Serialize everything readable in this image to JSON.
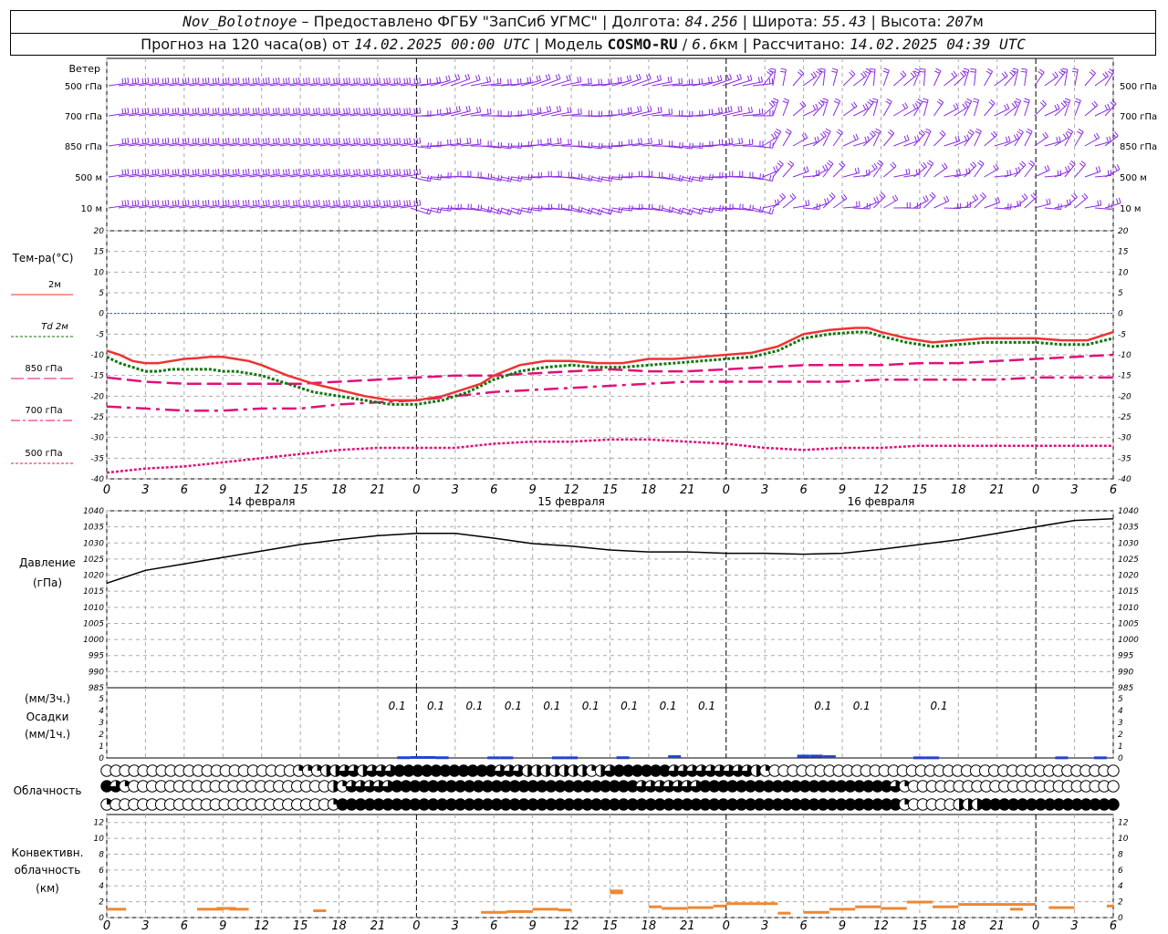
{
  "header": {
    "station": "Nov_Bolotnoye",
    "provider": "Предоставлено ФГБУ \"ЗапСиб УГМС\"",
    "lon_label": "Долгота:",
    "lon": "84.256",
    "lat_label": "Широта:",
    "lat": "55.43",
    "alt_label": "Высота:",
    "alt": "207",
    "alt_unit": "м",
    "forecast_prefix": "Прогноз на 120 часа(ов) от",
    "forecast_time": "14.02.2025 00:00 UTC",
    "model_label": "Модель",
    "model": "COSMO-RU",
    "resolution": "6.6",
    "resolution_unit": "км",
    "computed_label": "Рассчитано:",
    "computed_time": "14.02.2025 04:39 UTC"
  },
  "colors": {
    "wind": "#8a2be2",
    "t2m": "#ee3333",
    "td2m": "#117711",
    "t850": "#e0107a",
    "t700": "#e0107a",
    "t500": "#e0107a",
    "zero_line": "#3344ff",
    "pressure": "#000000",
    "precip": "#2244cc",
    "conv": "#ee8833",
    "grid": "#aaaaaa"
  },
  "labels": {
    "wind_title": "Ветер",
    "wind_levels": [
      "500 гПа",
      "700 гПа",
      "850 гПа",
      "500 м",
      "10 м"
    ],
    "temp_title": "Тем-ра(°С)",
    "temp_series": [
      "2м",
      "Td 2м",
      "850 гПа",
      "700 гПа",
      "500 гПа"
    ],
    "pressure_title": "Давление",
    "pressure_unit": "(гПа)",
    "precip_unit_3h": "(мм/3ч.)",
    "precip_title": "Осадки",
    "precip_unit_1h": "(мм/1ч.)",
    "cloud_title": "Облачность",
    "conv_title_1": "Конвективн.",
    "conv_title_2": "облачность",
    "conv_unit": "(км)",
    "date_labels": [
      "14 февраля",
      "15 февраля",
      "16 февраля"
    ]
  },
  "time_axis": {
    "tick_labels": [
      "0",
      "3",
      "6",
      "9",
      "12",
      "15",
      "18",
      "21",
      "0",
      "3",
      "6",
      "9",
      "12",
      "15",
      "18",
      "21",
      "0",
      "3",
      "6",
      "9",
      "12",
      "15",
      "18",
      "21",
      "0",
      "3",
      "6"
    ],
    "hours": [
      0,
      3,
      6,
      9,
      12,
      15,
      18,
      21,
      24,
      27,
      30,
      33,
      36,
      39,
      42,
      45,
      48,
      51,
      54,
      57,
      60,
      63,
      66,
      69,
      72,
      75,
      78
    ]
  },
  "chart_data": [
    {
      "type": "line",
      "ylim": [
        -40,
        20
      ],
      "yticks": [
        20,
        15,
        10,
        5,
        0,
        -5,
        -10,
        -15,
        -20,
        -25,
        -30,
        -35,
        -40
      ],
      "series": [
        {
          "name": "2м",
          "x": [
            0,
            1,
            2,
            3,
            4,
            5,
            6,
            7,
            8,
            9,
            10,
            11,
            12,
            14,
            16,
            18,
            20,
            22,
            24,
            26,
            28,
            29,
            30,
            32,
            34,
            36,
            38,
            40,
            42,
            44,
            46,
            48,
            50,
            52,
            54,
            56,
            58,
            59,
            60,
            62,
            64,
            66,
            68,
            70,
            72,
            74,
            76,
            78
          ],
          "values": [
            -9,
            -10,
            -11.5,
            -12,
            -12,
            -11.5,
            -11,
            -10.8,
            -10.5,
            -10.5,
            -11,
            -11.5,
            -12.5,
            -15,
            -17,
            -18.5,
            -20,
            -21,
            -21,
            -20,
            -18,
            -17,
            -15,
            -12.5,
            -11.5,
            -11.5,
            -12,
            -12,
            -11,
            -11,
            -10.5,
            -10,
            -9.5,
            -8,
            -5,
            -4,
            -3.5,
            -3.5,
            -4.5,
            -6,
            -7,
            -6.5,
            -6,
            -6,
            -6,
            -6.5,
            -6.5,
            -4.5
          ]
        },
        {
          "name": "Td 2м",
          "x": [
            0,
            1,
            2,
            3,
            4,
            5,
            6,
            7,
            8,
            9,
            10,
            11,
            12,
            14,
            16,
            18,
            20,
            22,
            24,
            26,
            28,
            29,
            30,
            32,
            34,
            36,
            38,
            40,
            42,
            44,
            46,
            48,
            50,
            52,
            54,
            56,
            58,
            59,
            60,
            62,
            64,
            66,
            68,
            70,
            72,
            74,
            76,
            78
          ],
          "values": [
            -10.5,
            -12,
            -13,
            -14,
            -14,
            -13.5,
            -13.5,
            -13.5,
            -13.5,
            -14,
            -14,
            -14.5,
            -15,
            -17,
            -19,
            -20,
            -21,
            -22,
            -22,
            -21,
            -19,
            -17.5,
            -16,
            -14,
            -13,
            -12.5,
            -13,
            -13,
            -12.5,
            -12,
            -11.5,
            -11,
            -10.5,
            -9,
            -6,
            -5,
            -4.5,
            -4.5,
            -5.5,
            -7,
            -8,
            -7.5,
            -7,
            -7,
            -7,
            -7.5,
            -7.5,
            -6
          ]
        },
        {
          "name": "850 гПа",
          "x": [
            0,
            3,
            6,
            9,
            12,
            15,
            18,
            21,
            24,
            27,
            30,
            33,
            36,
            39,
            42,
            45,
            48,
            51,
            54,
            57,
            60,
            63,
            66,
            69,
            72,
            75,
            78
          ],
          "values": [
            -15.5,
            -16.5,
            -17,
            -17,
            -17,
            -17,
            -16.5,
            -16,
            -15.5,
            -15,
            -15,
            -14.5,
            -14,
            -13.5,
            -14,
            -14,
            -13.5,
            -13,
            -12.5,
            -12.5,
            -12.5,
            -12,
            -12,
            -11.5,
            -11,
            -10.5,
            -10
          ]
        },
        {
          "name": "700 гПа",
          "x": [
            0,
            3,
            6,
            9,
            12,
            15,
            18,
            21,
            24,
            27,
            30,
            33,
            36,
            39,
            42,
            45,
            48,
            51,
            54,
            57,
            60,
            63,
            66,
            69,
            72,
            75,
            78
          ],
          "values": [
            -22.5,
            -23,
            -23.5,
            -23.5,
            -23,
            -23,
            -22,
            -21.5,
            -21,
            -20,
            -19,
            -18.5,
            -18,
            -17.5,
            -17,
            -16.5,
            -16.5,
            -16.5,
            -16.5,
            -16.5,
            -16,
            -16,
            -16,
            -16,
            -15.5,
            -15.5,
            -15.5
          ]
        },
        {
          "name": "500 гПа",
          "x": [
            0,
            3,
            6,
            9,
            12,
            15,
            18,
            21,
            24,
            27,
            30,
            33,
            36,
            39,
            42,
            45,
            48,
            51,
            54,
            57,
            60,
            63,
            66,
            69,
            72,
            75,
            78
          ],
          "values": [
            -38.5,
            -37.5,
            -37,
            -36,
            -35,
            -34,
            -33,
            -32.5,
            -32.5,
            -32.5,
            -31.5,
            -31,
            -31,
            -30.5,
            -30.5,
            -31,
            -31.5,
            -32.5,
            -33,
            -32.5,
            -32.5,
            -32,
            -32,
            -32,
            -32,
            -32,
            -32
          ]
        }
      ]
    },
    {
      "type": "line",
      "ylim": [
        985,
        1040
      ],
      "yticks": [
        1040,
        1035,
        1030,
        1025,
        1020,
        1015,
        1010,
        1005,
        1000,
        995,
        990,
        985
      ],
      "series": [
        {
          "name": "Давление",
          "x": [
            0,
            3,
            6,
            9,
            12,
            15,
            18,
            21,
            24,
            27,
            30,
            33,
            36,
            39,
            42,
            45,
            48,
            51,
            54,
            57,
            60,
            63,
            66,
            69,
            72,
            75,
            78
          ],
          "values": [
            1017.5,
            1021.5,
            1023.5,
            1025.5,
            1027.5,
            1029.5,
            1031,
            1032.3,
            1033,
            1033,
            1031.5,
            1029.8,
            1029,
            1027.8,
            1027.2,
            1027.2,
            1026.8,
            1026.8,
            1026.5,
            1026.8,
            1028,
            1029.5,
            1031,
            1033,
            1035,
            1037,
            1037.5
          ]
        }
      ]
    },
    {
      "type": "bar",
      "ylim": [
        0,
        5
      ],
      "labels_3h": [
        {
          "x": 22.5,
          "text": "0.1"
        },
        {
          "x": 25.5,
          "text": "0.1"
        },
        {
          "x": 28.5,
          "text": "0.1"
        },
        {
          "x": 31.5,
          "text": "0.1"
        },
        {
          "x": 34.5,
          "text": "0.1"
        },
        {
          "x": 37.5,
          "text": "0.1"
        },
        {
          "x": 40.5,
          "text": "0.1"
        },
        {
          "x": 43.5,
          "text": "0.1"
        },
        {
          "x": 46.5,
          "text": "0.1"
        },
        {
          "x": 55.5,
          "text": "0.1"
        },
        {
          "x": 58.5,
          "text": "0.1"
        },
        {
          "x": 64.5,
          "text": "0.1"
        }
      ],
      "bars_1h": [
        [
          23,
          0.06
        ],
        [
          24,
          0.08
        ],
        [
          25,
          0.08
        ],
        [
          26,
          0.06
        ],
        [
          30,
          0.05
        ],
        [
          31,
          0.05
        ],
        [
          35,
          0.05
        ],
        [
          36,
          0.05
        ],
        [
          40,
          0.06
        ],
        [
          44,
          0.15
        ],
        [
          54,
          0.2
        ],
        [
          55,
          0.2
        ],
        [
          56,
          0.15
        ],
        [
          63,
          0.05
        ],
        [
          64,
          0.05
        ],
        [
          74,
          0.05
        ],
        [
          77,
          0.05
        ]
      ]
    },
    {
      "type": "table",
      "name": "Облачность",
      "encoding": "0=clear, 1=quarter, 2=half, 3=three-quarter, 4=overcast",
      "rows": [
        "000000000000000000000111223323334444444444433322222221234444443333333332100000000000000000000000000000000000000",
        "4310000000000000000000000213333344444444444444444444444444433333334444444444444444444443100000000000000000000000",
        "1000000000000000000000000144444444444444444444444444444444444444444444444444444444444444100000222444444444444444"
      ]
    },
    {
      "type": "bar",
      "ylim": [
        0,
        13
      ],
      "yticks": [
        12,
        10,
        8,
        6,
        4,
        2,
        0
      ],
      "segments": [
        [
          0,
          1.5,
          1.0
        ],
        [
          7,
          9,
          1.0
        ],
        [
          8.5,
          10,
          1.1
        ],
        [
          9.5,
          11,
          1.0
        ],
        [
          16,
          17,
          0.8
        ],
        [
          29,
          31,
          0.6
        ],
        [
          31,
          33,
          0.7
        ],
        [
          33,
          35,
          1.0
        ],
        [
          35,
          36,
          0.9
        ],
        [
          39,
          40,
          3.3
        ],
        [
          42,
          43,
          1.3
        ],
        [
          43,
          45,
          1.1
        ],
        [
          45,
          47,
          1.2
        ],
        [
          47,
          48,
          1.4
        ],
        [
          48,
          52,
          1.7
        ],
        [
          52,
          53,
          0.5
        ],
        [
          54,
          56,
          0.6
        ],
        [
          56,
          58,
          1.0
        ],
        [
          58,
          60,
          1.3
        ],
        [
          60,
          62,
          1.1
        ],
        [
          62,
          64,
          1.9
        ],
        [
          64,
          66,
          1.3
        ],
        [
          66,
          72,
          1.6
        ],
        [
          70,
          71,
          1.0
        ],
        [
          73,
          75,
          1.2
        ],
        [
          77.5,
          78,
          1.4
        ]
      ]
    }
  ]
}
